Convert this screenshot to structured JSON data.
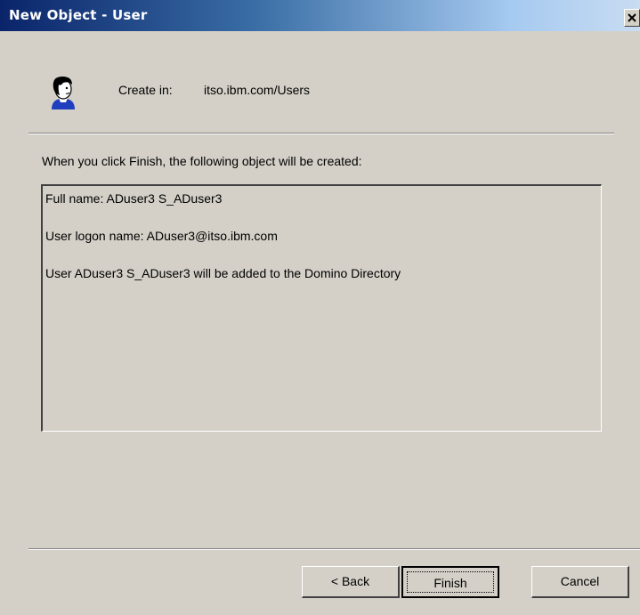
{
  "window": {
    "title": "New Object - User",
    "close_icon": "close-icon"
  },
  "header": {
    "icon": "user-icon",
    "create_in_label": "Create in:",
    "create_in_value": "itso.ibm.com/Users"
  },
  "main": {
    "intro_text": "When you click Finish, the following object will be created:",
    "summary_lines": [
      "Full name: ADuser3 S_ADuser3",
      "User logon name: ADuser3@itso.ibm.com",
      "User ADuser3 S_ADuser3 will be added to the Domino Directory"
    ]
  },
  "buttons": {
    "back": "< Back",
    "finish": "Finish",
    "cancel": "Cancel"
  },
  "colors": {
    "title_bar_start": "#0a246a",
    "title_bar_end": "#a6caf0",
    "dialog_face": "#d4d0c8"
  }
}
